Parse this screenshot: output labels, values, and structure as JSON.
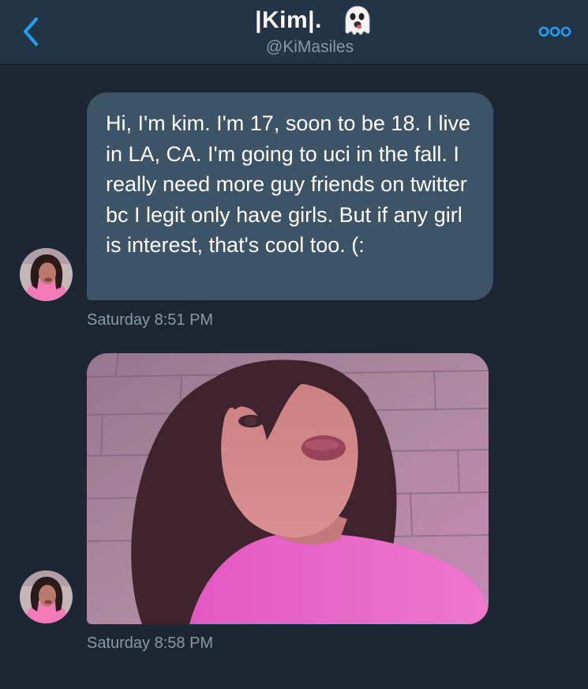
{
  "header": {
    "title": "|Kim|.",
    "handle": "@KiMasiles",
    "back_icon": "chevron-left-icon",
    "more_icon": "more-dots-icon",
    "title_emoji_icon": "ghost-icon",
    "accent_color": "#1da1f2"
  },
  "messages": [
    {
      "type": "text",
      "text": "Hi, I'm kim. I'm 17, soon to be 18. I live in LA, CA. I'm going to uci in the fall. I really need more guy friends on twitter bc I legit only have girls. But if any girl is interest, that's cool too. (:",
      "timestamp": "Saturday 8:51 PM"
    },
    {
      "type": "image",
      "timestamp": "Saturday 8:58 PM"
    }
  ],
  "colors": {
    "background": "#1c2733",
    "header_bg": "#243447",
    "bubble_bg": "#3d5466",
    "secondary_text": "#8899a6"
  }
}
